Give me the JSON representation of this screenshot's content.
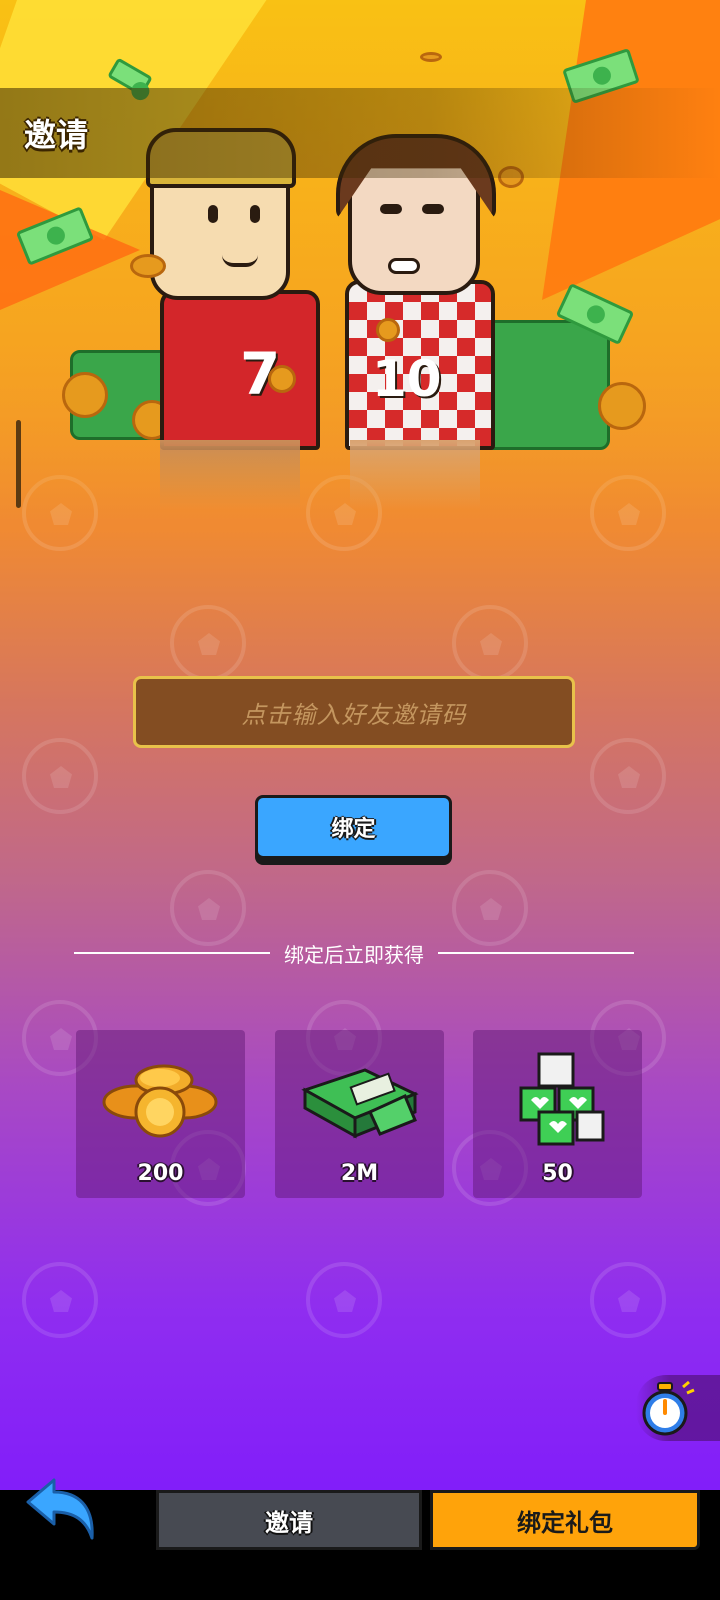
{
  "header": {
    "title": "邀请"
  },
  "invite_form": {
    "input_placeholder": "点击输入好友邀请码",
    "bind_button_label": "绑定"
  },
  "rewards_section": {
    "divider_text": "绑定后立即获得",
    "rewards": [
      {
        "icon": "gold-coins-icon",
        "amount": "200"
      },
      {
        "icon": "cash-stack-icon",
        "amount": "2M"
      },
      {
        "icon": "green-heart-cubes-icon",
        "amount": "50"
      }
    ]
  },
  "bottom_nav": {
    "back_icon": "back-arrow-icon",
    "tabs": [
      {
        "label": "邀请",
        "active": false
      },
      {
        "label": "绑定礼包",
        "active": true
      }
    ]
  },
  "floating": {
    "timer_icon": "stopwatch-icon"
  },
  "colors": {
    "bind_button": "#3aa6ff",
    "active_tab": "#ffa30a",
    "inactive_tab": "#474a52",
    "input_bg": "#834d22",
    "input_border": "#e8c24a"
  }
}
